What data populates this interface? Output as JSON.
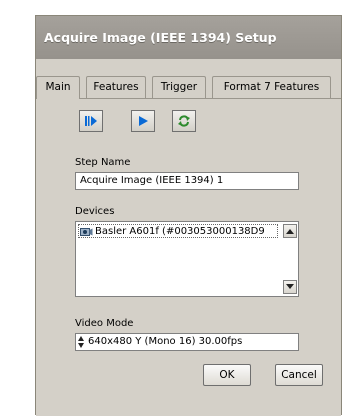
{
  "window": {
    "title": "Acquire Image (IEEE 1394) Setup"
  },
  "tabs": [
    {
      "label": "Main",
      "active": true
    },
    {
      "label": "Features",
      "active": false
    },
    {
      "label": "Trigger",
      "active": false
    },
    {
      "label": "Format 7 Features",
      "active": false
    }
  ],
  "toolbar": {
    "buttons": [
      {
        "icon": "step-play-icon"
      },
      {
        "icon": "play-icon"
      },
      {
        "icon": "refresh-icon"
      }
    ]
  },
  "step_name": {
    "label": "Step Name",
    "value": "Acquire Image (IEEE 1394) 1"
  },
  "devices": {
    "label": "Devices",
    "items": [
      {
        "label": "Basler A601f (#003053000138D9",
        "icon": "camera-icon"
      }
    ]
  },
  "video_mode": {
    "label": "Video Mode",
    "value": "640x480 Y (Mono 16) 30.00fps"
  },
  "buttons": {
    "ok": "OK",
    "cancel": "Cancel"
  },
  "colors": {
    "accent": "#0a6ad6",
    "refresh": "#2e8b2e"
  }
}
